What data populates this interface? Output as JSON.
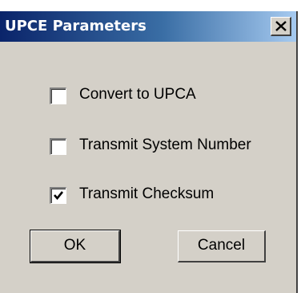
{
  "window": {
    "title": "UPCE Parameters",
    "close_icon": "close-icon"
  },
  "options": [
    {
      "label": "Convert to UPCA",
      "checked": false
    },
    {
      "label": "Transmit System Number",
      "checked": false
    },
    {
      "label": "Transmit Checksum",
      "checked": true
    }
  ],
  "buttons": {
    "ok_label": "OK",
    "cancel_label": "Cancel"
  },
  "colors": {
    "titlebar_start": "#0a246a",
    "titlebar_end": "#a6caf0",
    "dialog_bg": "#d4d0c8"
  }
}
